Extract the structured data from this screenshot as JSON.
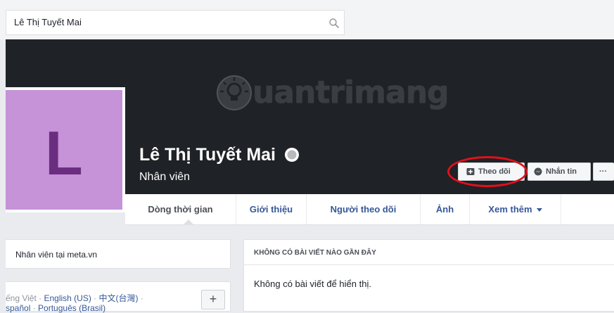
{
  "search": {
    "value": "Lê Thị Tuyết Mai"
  },
  "cover": {
    "watermark_text": "uantrimang"
  },
  "profile": {
    "avatar_letter": "L",
    "name": "Lê Thị Tuyết Mai",
    "role": "Nhân viên"
  },
  "actions": {
    "follow_label": "Theo dõi",
    "message_label": "Nhắn tin",
    "more_label": "···"
  },
  "tabs": [
    {
      "label": "Dòng thời gian",
      "active": true
    },
    {
      "label": "Giới thiệu"
    },
    {
      "label": "Người theo dõi"
    },
    {
      "label": "Ảnh"
    },
    {
      "label": "Xem thêm"
    }
  ],
  "intro": {
    "text": "Nhân viên tại meta.vn"
  },
  "languages": {
    "line1_prefix": "ếng Việt · ",
    "english": "English (US)",
    "sep1": " · ",
    "chinese": "中文(台灣)",
    "sep2": " ·",
    "line2_spanish": "spañol",
    "sep3": " · ",
    "portuguese": "Português (Brasil)",
    "add_label": "+"
  },
  "posts": {
    "title": "KHÔNG CÓ BÀI VIẾT NÀO GẦN ĐÂY",
    "empty_text": "Không có bài viết để hiển thị."
  },
  "colors": {
    "cover": "#1f2226",
    "avatar_bg": "#c692d8",
    "avatar_letter": "#6b2d7f",
    "link": "#365899",
    "highlight": "#e0101b"
  }
}
